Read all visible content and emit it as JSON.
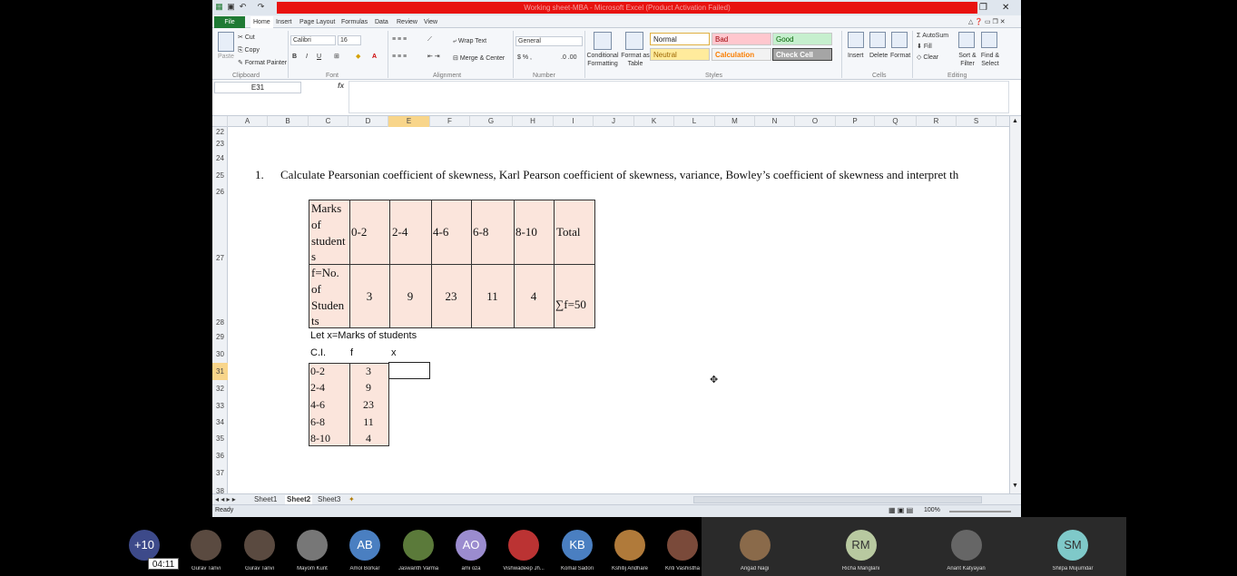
{
  "window": {
    "title": "Working sheet-MBA  -  Microsoft Excel (Product Activation Failed)"
  },
  "ribbon_tabs": [
    "File",
    "Home",
    "Insert",
    "Page Layout",
    "Formulas",
    "Data",
    "Review",
    "View"
  ],
  "clipboard": {
    "paste": "Paste",
    "cut": "Cut",
    "copy": "Copy",
    "format_painter": "Format Painter",
    "label": "Clipboard"
  },
  "font": {
    "name": "Calibri",
    "size": "16",
    "bold": "B",
    "italic": "I",
    "underline": "U",
    "label": "Font"
  },
  "alignment": {
    "wrap": "Wrap Text",
    "merge": "Merge & Center",
    "label": "Alignment"
  },
  "number": {
    "format": "General",
    "label": "Number"
  },
  "styles": {
    "conditional": "Conditional Formatting",
    "format_as": "Format as Table",
    "normal": "Normal",
    "bad": "Bad",
    "good": "Good",
    "neutral": "Neutral",
    "calculation": "Calculation",
    "check": "Check Cell",
    "label": "Styles"
  },
  "cells_grp": {
    "insert": "Insert",
    "delete": "Delete",
    "format": "Format",
    "label": "Cells"
  },
  "editing": {
    "autosum": "AutoSum",
    "fill": "Fill",
    "clear": "Clear",
    "sort": "Sort & Filter",
    "find": "Find & Select",
    "label": "Editing"
  },
  "formula_bar": {
    "name_box": "E31",
    "fx": "fx",
    "value": ""
  },
  "columns": [
    "A",
    "B",
    "C",
    "D",
    "E",
    "F",
    "G",
    "H",
    "I",
    "J",
    "K",
    "L",
    "M",
    "N",
    "O",
    "P",
    "Q",
    "R",
    "S"
  ],
  "rows": [
    "22",
    "23",
    "24",
    "25",
    "26",
    "27",
    "28",
    "29",
    "30",
    "31",
    "32",
    "33",
    "34",
    "35",
    "36",
    "37",
    "38"
  ],
  "question": {
    "num": "1.",
    "text": "Calculate Pearsonian coefficient of skewness, Karl Pearson coefficient of skewness, variance, Bowley’s coefficient of skewness and interpret th"
  },
  "table1": {
    "row1": [
      "Marks of student s",
      "0-2",
      "2-4",
      "4-6",
      "6-8",
      "8-10",
      "Total"
    ],
    "row1_lines": [
      "Marks",
      "of",
      "student",
      "s"
    ],
    "row2_lines": [
      "f=No.",
      "of",
      "Studen",
      "ts"
    ],
    "row2": [
      "3",
      "9",
      "23",
      "11",
      "4",
      "∑f=50"
    ]
  },
  "let_text": "Let x=Marks of students",
  "table2": {
    "headers": [
      "C.I.",
      "f",
      "x"
    ],
    "rows": [
      [
        "0-2",
        "3"
      ],
      [
        "2-4",
        "9"
      ],
      [
        "4-6",
        "23"
      ],
      [
        "6-8",
        "11"
      ],
      [
        "8-10",
        "4"
      ]
    ]
  },
  "sheets": [
    "Sheet1",
    "Sheet2",
    "Sheet3"
  ],
  "active_sheet": "Sheet2",
  "status": {
    "ready": "Ready",
    "zoom": "100%"
  },
  "participants": [
    {
      "initials": "+10",
      "name": "",
      "color": "#3d4a8a"
    },
    {
      "initials": "",
      "name": "Gurav Tanvi",
      "color": "#5a4a40"
    },
    {
      "initials": "",
      "name": "Gurav Tanvi",
      "color": "#5a4a40"
    },
    {
      "initials": "",
      "name": "Mayom Kunt",
      "color": "#777"
    },
    {
      "initials": "AB",
      "name": "Amol Borkar",
      "color": "#4a7fc1"
    },
    {
      "initials": "",
      "name": "Jaswanth Varma",
      "color": "#5b7a3a"
    },
    {
      "initials": "AO",
      "name": "ami oza",
      "color": "#9b8ccf"
    },
    {
      "initials": "",
      "name": "Vishwadeep Jh...",
      "color": "#b33"
    },
    {
      "initials": "KB",
      "name": "Komal Sadori",
      "color": "#4a7fc1"
    },
    {
      "initials": "",
      "name": "Kshitij Andhare",
      "color": "#b07a3a"
    },
    {
      "initials": "",
      "name": "Kriti Vashistha",
      "color": "#7a4a3a"
    },
    {
      "initials": "",
      "name": "Angad Nagi",
      "color": "#8a6a4a"
    },
    {
      "initials": "RM",
      "name": "Richa Manglani",
      "color": "#b8c9a0"
    },
    {
      "initials": "",
      "name": "Anant Katyayan",
      "color": "#666"
    },
    {
      "initials": "SM",
      "name": "Shilpa Mujumdar",
      "color": "#7fc9c9"
    }
  ],
  "timer": "04:11"
}
